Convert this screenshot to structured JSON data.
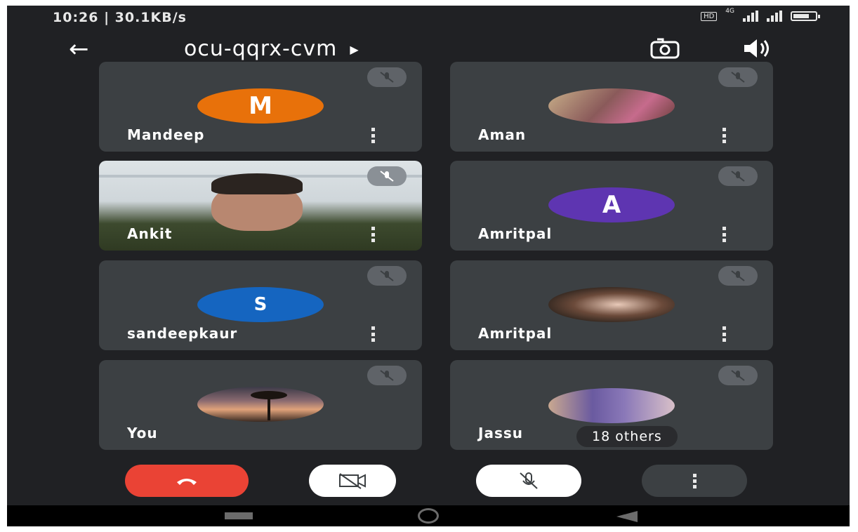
{
  "status_bar": {
    "time_speed": "10:26 | 30.1KB/s",
    "hd_badge": "HD",
    "network": "4G"
  },
  "header": {
    "back_icon": "arrow-back-icon",
    "meeting_code": "ocu-qqrx-cvm",
    "caret_icon": "triangle-right-icon",
    "switch_camera_icon": "camera-switch-icon",
    "speaker_icon": "speaker-icon"
  },
  "participants": [
    {
      "name": "Mandeep",
      "avatar_letter": "M",
      "avatar_color": "#e8710a",
      "type": "letter"
    },
    {
      "name": "Aman",
      "avatar_letter": "",
      "avatar_color": "#a8745a",
      "type": "photo"
    },
    {
      "name": "Ankit",
      "avatar_letter": "",
      "avatar_color": "",
      "type": "video"
    },
    {
      "name": "Amritpal",
      "avatar_letter": "A",
      "avatar_color": "#5e35b1",
      "type": "letter"
    },
    {
      "name": "sandeepkaur",
      "avatar_letter": "S",
      "avatar_color": "#1565c0",
      "type": "letter"
    },
    {
      "name": "Amritpal",
      "avatar_letter": "",
      "avatar_color": "#6b4a3a",
      "type": "photo"
    },
    {
      "name": "You",
      "avatar_letter": "",
      "avatar_color": "#c07a5a",
      "type": "photo"
    },
    {
      "name": "Jassu",
      "avatar_letter": "",
      "avatar_color": "#7a6aa0",
      "type": "photo"
    }
  ],
  "others_chip": "18 others",
  "controls": {
    "end_call_color": "#ea4335",
    "end_call_icon": "phone-hangup-icon",
    "camera_off_icon": "videocam-off-icon",
    "mic_off_icon": "mic-off-icon",
    "more_icon": "more-vert-icon"
  },
  "colors": {
    "background": "#202124",
    "tile": "#3c4043",
    "mute_badge": "#5f6368"
  }
}
